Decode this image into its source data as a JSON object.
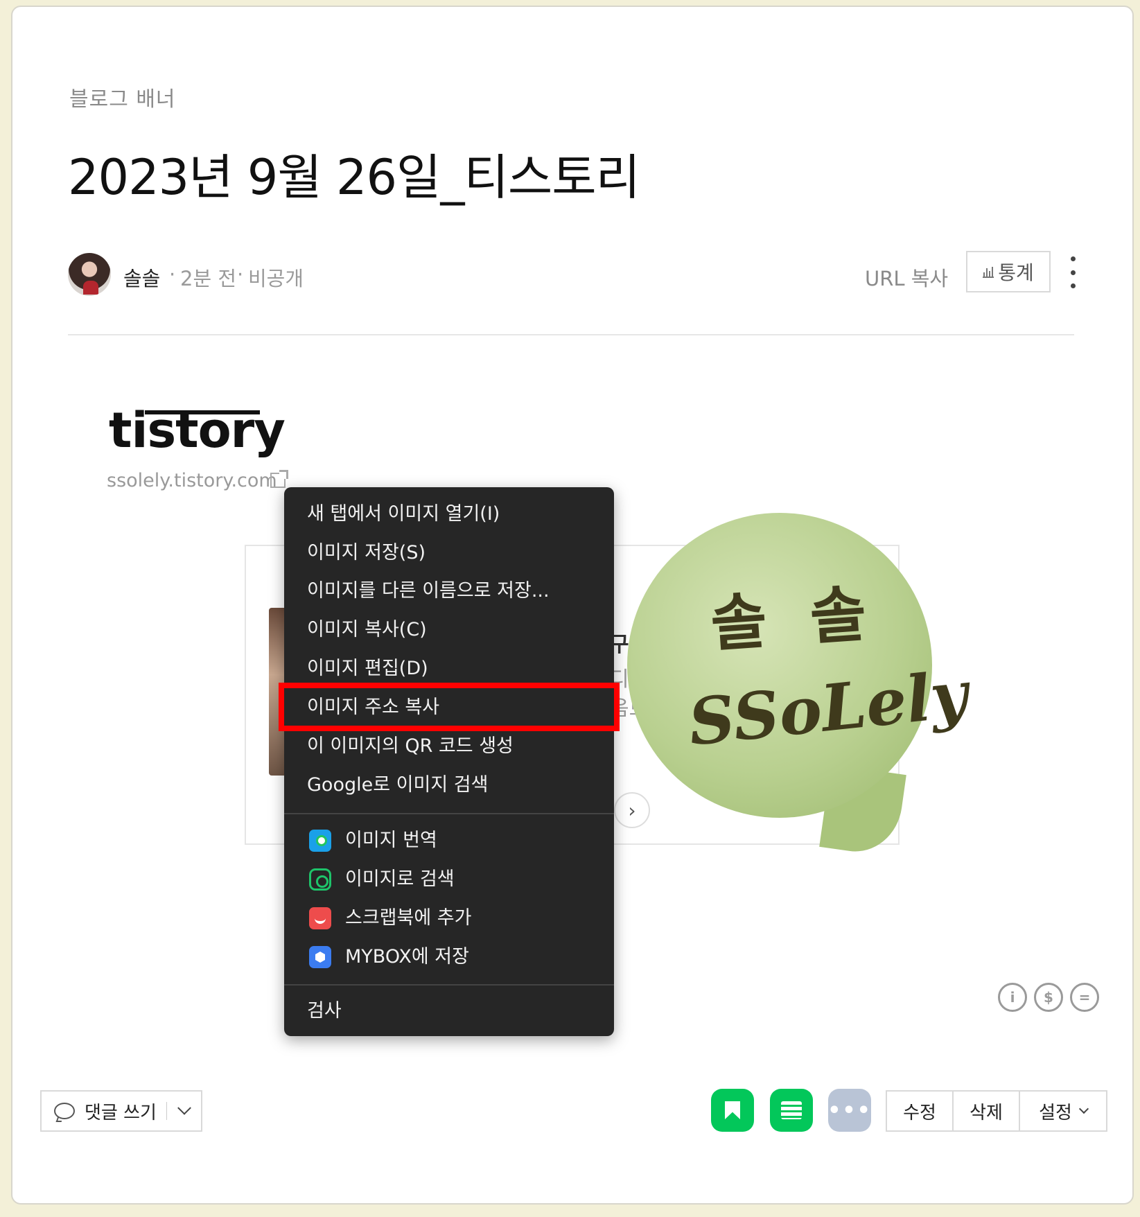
{
  "post": {
    "category": "블로그 배너",
    "title": "2023년 9월 26일_티스토리",
    "author": "솔솔",
    "time": "2분 전",
    "visibility": "비공개",
    "url_copy": "URL 복사",
    "stats": "통계"
  },
  "content": {
    "logo_text": "tistory",
    "blog_url": "ssolely.tistory.com",
    "embed_text": [
      "구미 꿈",
      "디저트카페",
      "음료 자 맛"
    ],
    "bubble_line1": "솔 솔",
    "bubble_line2": "SSoLely"
  },
  "context_menu": {
    "items": [
      "새 탭에서 이미지 열기(I)",
      "이미지 저장(S)",
      "이미지를 다른 이름으로 저장...",
      "이미지 복사(C)",
      "이미지 편집(D)",
      "이미지 주소 복사",
      "이 이미지의 QR 코드 생성",
      "Google로 이미지 검색"
    ],
    "extension_items": [
      {
        "label": "이미지 번역",
        "icon": "papago-icon"
      },
      {
        "label": "이미지로 검색",
        "icon": "lens-icon"
      },
      {
        "label": "스크랩북에 추가",
        "icon": "scrapbook-icon"
      },
      {
        "label": "MYBOX에 저장",
        "icon": "mybox-icon"
      }
    ],
    "inspect": "검사",
    "highlighted_item": "이미지 주소 복사",
    "highlight_color": "#ff0000"
  },
  "footer": {
    "comment": "댓글 쓰기",
    "more": "•••",
    "actions": [
      "수정",
      "삭제",
      "설정"
    ]
  },
  "colors": {
    "naver_green": "#03c75a",
    "menu_bg": "#262626",
    "page_bg": "#f3f0d8"
  }
}
